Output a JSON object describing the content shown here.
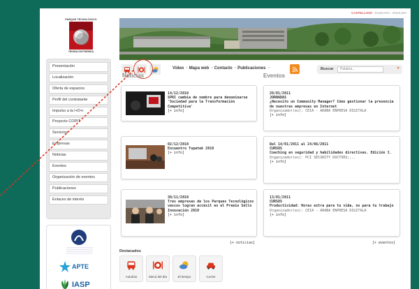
{
  "lang": {
    "active": "CASTELLANO",
    "others": "· EUSKARA · ENGLISH"
  },
  "logo": {
    "top": "PARQUE TECNOLÓGICO",
    "bottom": "TEKNOLOGI PARKEA"
  },
  "toolbar": {
    "nav": [
      "Vídeo",
      "Mapa web",
      "Contacto",
      "Publicaciones"
    ],
    "search_label": "Buscar",
    "search_placeholder": "Palabra..."
  },
  "sidebar": {
    "items": [
      "Presentación",
      "Localización",
      "Oferta de espacios",
      "Perfil del contratante",
      "Impulso a la I+D+i",
      "Proyecto COPIT",
      "Servicios",
      "Empresas",
      "Noticias",
      "Eventos",
      "Organización de eventos",
      "Publicaciones",
      "Enlaces de interés"
    ]
  },
  "partners": {
    "p2": "APTE",
    "p3": "IASP"
  },
  "news": {
    "title": "Noticias",
    "more": "[+ noticias]",
    "items": [
      {
        "date": "14/12/2010",
        "title": "SPRI cambia de nombre para denominarse 'Sociedad para la Transformación Competitiva'",
        "link": "[+ info]"
      },
      {
        "date": "02/12/2010",
        "title": "Encuentro Topatek 2010",
        "link": "[+ info]"
      },
      {
        "date": "30/11/2010",
        "title": "Tres empresas de los Parques Tecnológicos vascos logran accésit en el Premio Sello Innovación 2010",
        "link": "[+ info]"
      }
    ]
  },
  "events": {
    "title": "Eventos",
    "more": "[+ eventos]",
    "items": [
      {
        "date": "20/01/2011",
        "type": "JORNADAS",
        "desc": "¿Necesito un Community Manager? Cómo gestionar la presencia de nuestras empresas en Internet",
        "org": "Organizador(es): CEIA - ARABA ENPRESA DIGITALA",
        "link": "[+ info]"
      },
      {
        "date": "Del 14/01/2011 al 24/06/2011",
        "type": "CURSOS",
        "desc": "Coaching en seguridad y habilidades directivas. Edición I.",
        "org": "Organizador(es): PCI SECURITY DOCTORS;...",
        "link": "[+ info]"
      },
      {
        "date": "13/01/2011",
        "type": "CURSOS",
        "desc": "Productividad: Horas extra para tu vida, no para tu trabajo",
        "org": "Organizador(es): CEIA - ARABA ENPRESA DIGITALA",
        "link": "[+ info]"
      }
    ]
  },
  "destacados": {
    "title": "Destacados",
    "items": [
      "Autobús",
      "Menú del día",
      "El tiempo",
      "Coche"
    ]
  },
  "colors": {
    "background": "#0e6b59",
    "accent_red": "#c0141d",
    "rss": "#f08b20"
  }
}
